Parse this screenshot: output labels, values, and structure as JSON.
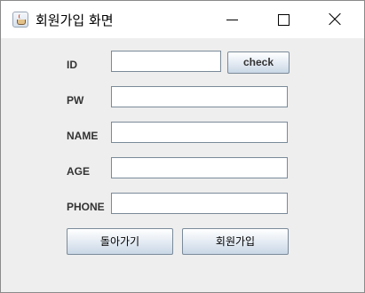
{
  "window": {
    "title": "회원가입 화면",
    "icon": "java-cup-icon"
  },
  "form": {
    "id_label": "ID",
    "id_value": "",
    "check_label": "check",
    "pw_label": "PW",
    "pw_value": "",
    "name_label": "NAME",
    "name_value": "",
    "age_label": "AGE",
    "age_value": "",
    "phone_label": "PHONE",
    "phone_value": ""
  },
  "buttons": {
    "back_label": "돌아가기",
    "signup_label": "회원가입"
  },
  "colors": {
    "window_bg": "#eeeeee",
    "titlebar_bg": "#ffffff",
    "field_border": "#7a8a99",
    "button_gradient_top": "#ffffff",
    "button_gradient_bottom": "#c9d7e6"
  }
}
